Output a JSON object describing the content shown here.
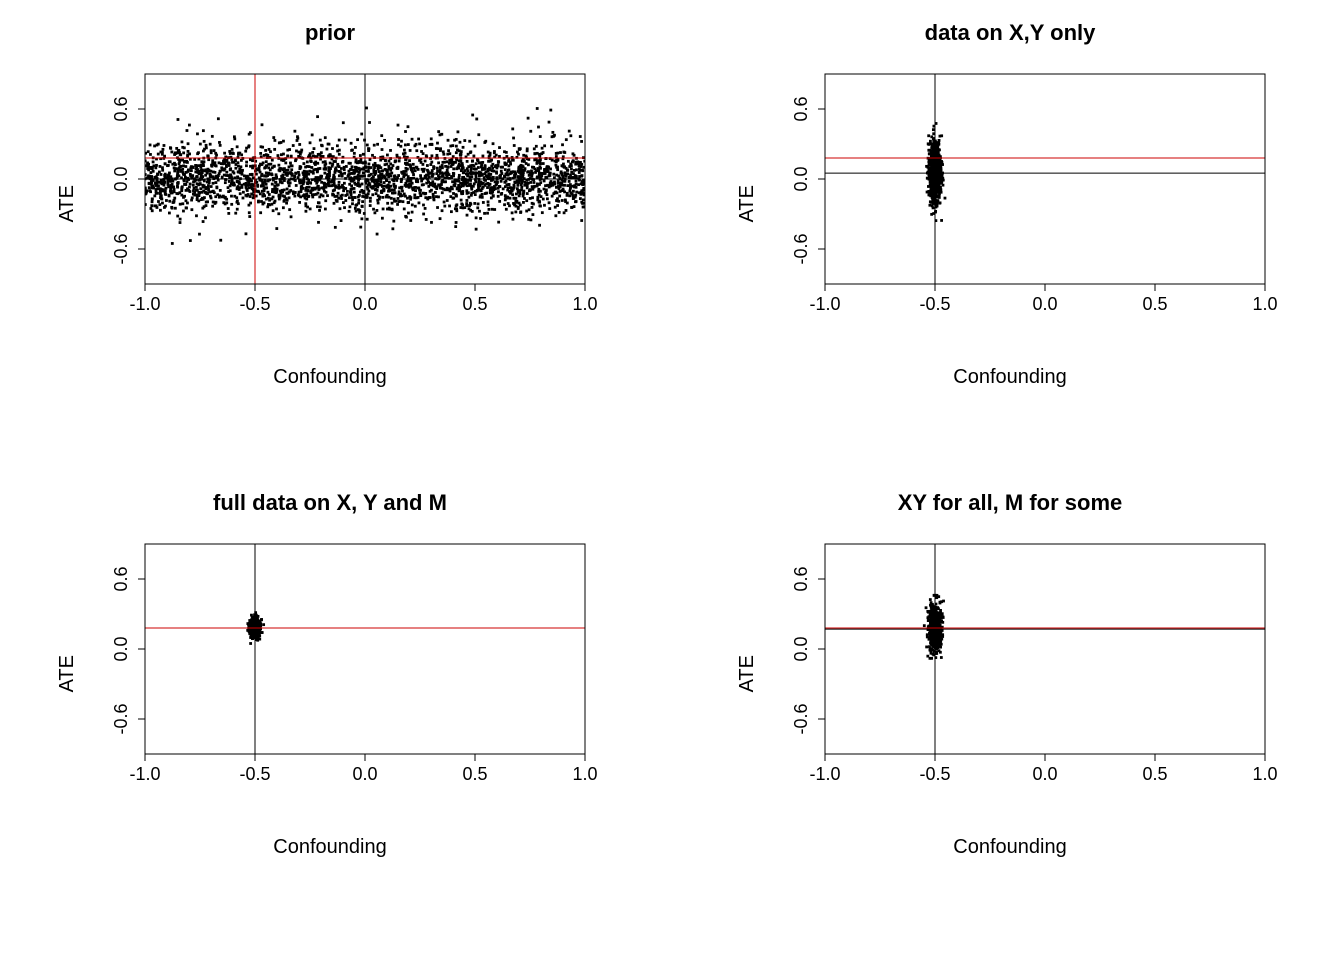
{
  "chart_data": [
    {
      "id": "prior",
      "type": "scatter",
      "title": "prior",
      "xlabel": "Confounding",
      "ylabel": "ATE",
      "xlim": [
        -1.0,
        1.0
      ],
      "ylim": [
        -0.9,
        0.9
      ],
      "xticks": [
        -1.0,
        -0.5,
        0.0,
        0.5,
        1.0
      ],
      "yticks": [
        -0.6,
        0.0,
        0.6
      ],
      "points_desc": "~3000 uniform draws across entire plot; x ~ U(-1,1), y concentrated roughly N(0, 0.18) with outliers up to ±0.7",
      "series": [],
      "reference_lines": {
        "vline_black": 0.0,
        "hline_black": 0.0,
        "vline_red": -0.5,
        "hline_red": 0.18
      }
    },
    {
      "id": "xy_only",
      "type": "scatter",
      "title": "data on X,Y only",
      "xlabel": "Confounding",
      "ylabel": "ATE",
      "xlim": [
        -1.0,
        1.0
      ],
      "ylim": [
        -0.9,
        0.9
      ],
      "xticks": [
        -1.0,
        -0.5,
        0.0,
        0.5,
        1.0
      ],
      "yticks": [
        -0.6,
        0.0,
        0.6
      ],
      "points_desc": "dense vertical cluster around x ≈ -0.5, y spanning roughly -0.45 to 0.45, concentrated near y≈0.05",
      "series": [],
      "reference_lines": {
        "vline_black": -0.5,
        "hline_black": 0.05,
        "hline_red": 0.18
      }
    },
    {
      "id": "full_xy_m",
      "type": "scatter",
      "title": "full data on X, Y and M",
      "xlabel": "Confounding",
      "ylabel": "ATE",
      "xlim": [
        -1.0,
        1.0
      ],
      "ylim": [
        -0.9,
        0.9
      ],
      "xticks": [
        -1.0,
        -0.5,
        0.0,
        0.5,
        1.0
      ],
      "yticks": [
        -0.6,
        0.0,
        0.6
      ],
      "points_desc": "tight cluster around x ≈ -0.5, y ≈ 0.18, spread y roughly 0.05 to 0.3",
      "series": [],
      "reference_lines": {
        "vline_black": -0.5,
        "hline_black": 0.18,
        "hline_red": 0.18
      }
    },
    {
      "id": "xy_all_m_some",
      "type": "scatter",
      "title": "XY for all, M for some",
      "xlabel": "Confounding",
      "ylabel": "ATE",
      "xlim": [
        -1.0,
        1.0
      ],
      "ylim": [
        -0.9,
        0.9
      ],
      "xticks": [
        -1.0,
        -0.5,
        0.0,
        0.5,
        1.0
      ],
      "yticks": [
        -0.6,
        0.0,
        0.6
      ],
      "points_desc": "vertical cluster around x ≈ -0.5, y spanning roughly -0.05 to 0.45, concentrated near y≈0.18",
      "series": [],
      "reference_lines": {
        "vline_black": -0.5,
        "hline_black": 0.17,
        "hline_red": 0.18
      }
    }
  ],
  "colors": {
    "red": "#c00000",
    "black": "#000000"
  }
}
